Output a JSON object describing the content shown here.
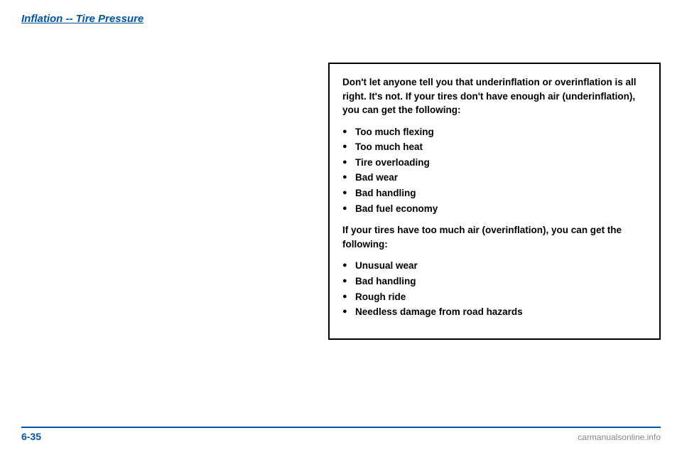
{
  "header": {
    "title": "Inflation -- Tire Pressure"
  },
  "footer": {
    "page_number": "6-35",
    "watermark": "carmanualsonline.info"
  },
  "infobox": {
    "paragraph1": "Don't let anyone tell you that underinflation or overinflation is all right. It's not. If your tires don't have enough air (underinflation), you can get the following:",
    "underinflation_bullets": [
      "Too much flexing",
      "Too much heat",
      "Tire overloading",
      "Bad wear",
      "Bad handling",
      "Bad fuel economy"
    ],
    "paragraph2": "If your tires have too much air (overinflation), you can get the following:",
    "overinflation_bullets": [
      "Unusual wear",
      "Bad handling",
      "Rough ride",
      "Needless damage from road hazards"
    ]
  }
}
